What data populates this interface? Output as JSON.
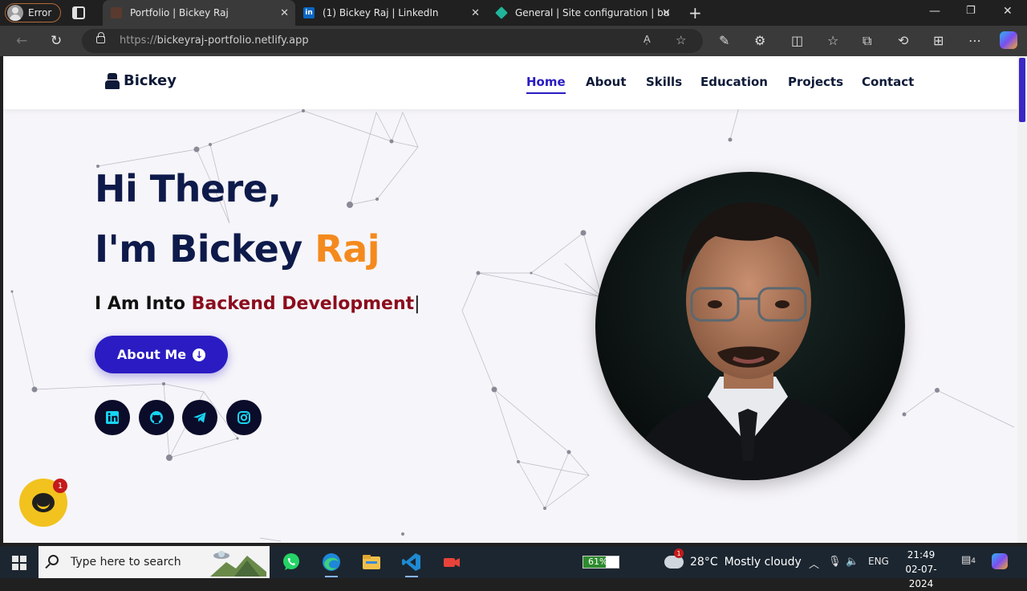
{
  "browser": {
    "profile_label": "Error",
    "tabs": [
      {
        "title": "Portfolio | Bickey Raj",
        "active": true
      },
      {
        "title": "(1) Bickey Raj | LinkedIn",
        "active": false
      },
      {
        "title": "General | Site configuration | bu",
        "active": false
      }
    ],
    "url_protocol": "https://",
    "url_host": "bickeyraj-portfolio.netlify.app"
  },
  "site": {
    "brand": "Bickey",
    "nav": [
      "Home",
      "About",
      "Skills",
      "Education",
      "Projects",
      "Contact"
    ],
    "active_nav": "Home",
    "hero": {
      "line1": "Hi There,",
      "line2_prefix": "I'm Bickey ",
      "line2_highlight": "Raj",
      "into_prefix": "I Am Into ",
      "into_typed": "Backend Development",
      "caret": "|",
      "button_label": "About Me"
    },
    "social": [
      "linkedin-icon",
      "github-icon",
      "telegram-icon",
      "instagram-icon"
    ],
    "chat_badge": "1"
  },
  "taskbar": {
    "search_placeholder": "Type here to search",
    "battery": "61%",
    "weather_badge": "1",
    "temperature": "28°C",
    "weather_desc": "Mostly cloudy",
    "language": "ENG",
    "time": "21:49",
    "date": "02-07-2024",
    "notif_count": "4"
  },
  "colors": {
    "primary": "#2a1cc2",
    "heading": "#0e1a4a",
    "accent_orange": "#f48a1e",
    "typed_red": "#8b0d1d"
  }
}
